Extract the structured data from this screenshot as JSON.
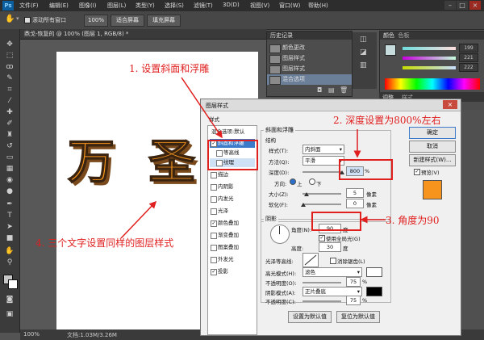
{
  "menubar": {
    "app_icon": "Ps",
    "items": [
      "文件(F)",
      "编辑(E)",
      "图像(I)",
      "图层(L)",
      "类型(Y)",
      "选择(S)",
      "滤镜(T)",
      "3D(D)",
      "视图(V)",
      "窗口(W)",
      "帮助(H)"
    ]
  },
  "optionsbar": {
    "scroll_all": "滚动所有窗口",
    "zoom": "100%",
    "fit_screen": "适合屏幕",
    "fill_screen": "填充屏幕"
  },
  "document": {
    "tab_title": "鼎戈-恢复的 @ 100% (图层 1, RGB/8) *",
    "status_zoom": "100%",
    "status_doc": "文档:1.03M/3.26M"
  },
  "history": {
    "tab": "历史记录",
    "items": [
      "颜色更改",
      "图层样式",
      "图层样式",
      "混合选项"
    ]
  },
  "color_panel": {
    "tab1": "颜色",
    "tab2": "色板",
    "values": [
      "199",
      "221",
      "222"
    ],
    "adjust_tab": "调整",
    "styles_tab": "样式"
  },
  "annotations": {
    "a1": "1. 设置斜面和浮雕",
    "a2": "2. 深度设置为800%左右",
    "a3": "3. 角度为90",
    "a4": "4. 三个文字设置同样的图层样式"
  },
  "dialog": {
    "title": "图层样式",
    "styles_header": "样式",
    "blend_default": "混合选项:默认",
    "style_items": [
      {
        "label": "斜面和浮雕",
        "checked": true,
        "selected": true
      },
      {
        "label": "等高线",
        "checked": false,
        "sub": true
      },
      {
        "label": "纹理",
        "checked": false,
        "sub": true
      },
      {
        "label": "描边",
        "checked": false
      },
      {
        "label": "内阴影",
        "checked": false
      },
      {
        "label": "内发光",
        "checked": false
      },
      {
        "label": "光泽",
        "checked": false
      },
      {
        "label": "颜色叠加",
        "checked": true
      },
      {
        "label": "渐变叠加",
        "checked": false
      },
      {
        "label": "图案叠加",
        "checked": false
      },
      {
        "label": "外发光",
        "checked": false
      },
      {
        "label": "投影",
        "checked": true
      }
    ],
    "bevel_title": "斜面和浮雕",
    "structure": "结构",
    "style_label": "样式(T):",
    "style_value": "内斜面",
    "technique_label": "方法(Q):",
    "technique_value": "平滑",
    "depth_label": "深度(D):",
    "depth_value": "800",
    "depth_unit": "%",
    "direction_label": "方向:",
    "direction_up": "上",
    "direction_down": "下",
    "size_label": "大小(Z):",
    "size_value": "5",
    "size_unit": "像素",
    "soften_label": "软化(F):",
    "soften_value": "0",
    "soften_unit": "像素",
    "shading": "阴影",
    "angle_label": "角度(N):",
    "angle_value": "90",
    "angle_unit": "度",
    "global_light": "使用全局光(G)",
    "altitude_label": "高度:",
    "altitude_value": "30",
    "altitude_unit": "度",
    "gloss_label": "光泽等高线:",
    "antialias": "消除锯齿(L)",
    "highlight_label": "高光模式(H):",
    "highlight_value": "滤色",
    "opacity1_label": "不透明度(O):",
    "opacity1_value": "75",
    "shadow_label": "阴影模式(A):",
    "shadow_value": "正片叠底",
    "opacity2_label": "不透明度(C):",
    "opacity2_value": "75",
    "percent": "%",
    "make_default": "设置为默认值",
    "reset_default": "复位为默认值",
    "ok": "确定",
    "cancel": "取消",
    "new_style": "新建样式(W)...",
    "preview": "预览(V)"
  },
  "colors": {
    "accent_red": "#e01f1f",
    "orange": "#f7941d",
    "selection_blue": "#3b79c9"
  }
}
